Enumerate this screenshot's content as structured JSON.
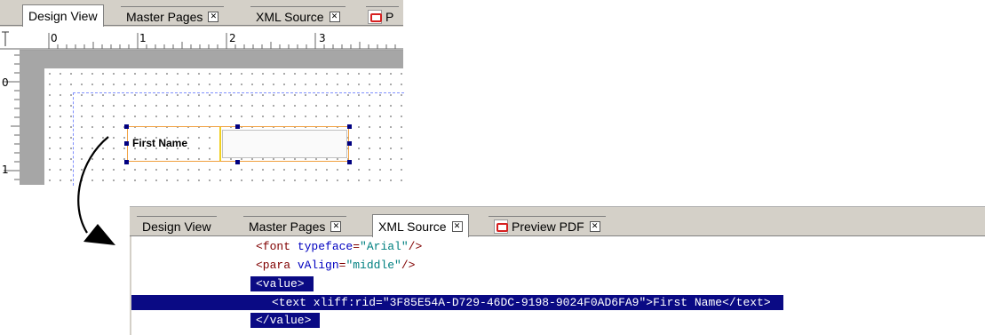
{
  "top": {
    "tabs": [
      {
        "label": "Design View",
        "closable": false,
        "active": true
      },
      {
        "label": "Master Pages",
        "closable": true,
        "active": false
      },
      {
        "label": "XML Source",
        "closable": true,
        "active": false
      },
      {
        "label": "P",
        "closable": false,
        "active": false
      }
    ],
    "ruler_h_numbers": [
      "0",
      "1",
      "2",
      "3"
    ],
    "ruler_v_numbers": [
      "0",
      "1"
    ],
    "field_label": "First Name"
  },
  "bottom": {
    "tabs": [
      {
        "label": "Design View",
        "closable": false,
        "active": false
      },
      {
        "label": "Master Pages",
        "closable": true,
        "active": false
      },
      {
        "label": "XML Source",
        "closable": true,
        "active": true
      },
      {
        "label": "Preview PDF",
        "closable": true,
        "active": false
      }
    ],
    "code": {
      "line1": {
        "open": "<font ",
        "attr": "typeface",
        "eq": "=",
        "value": "\"Arial\"",
        "close": "/>"
      },
      "line2": {
        "open": "<para ",
        "attr": "vAlign",
        "eq": "=",
        "value": "\"middle\"",
        "close": "/>"
      },
      "line3": "<value>",
      "line4": "<text xliff:rid=\"3F85E54A-D729-46DC-9198-9024F0AD6FA9\">First Name</text>",
      "line5": "</value>"
    }
  },
  "colors": {
    "selection": "#0a0a84",
    "field_border": "#f0a040",
    "handle": "#000080",
    "canvas_gray": "#a6a6a6",
    "panel_bg": "#d4d0c8"
  },
  "icons": {
    "pdf": "pdf-icon",
    "close": "close-icon",
    "arrow": "curved-arrow-icon"
  }
}
